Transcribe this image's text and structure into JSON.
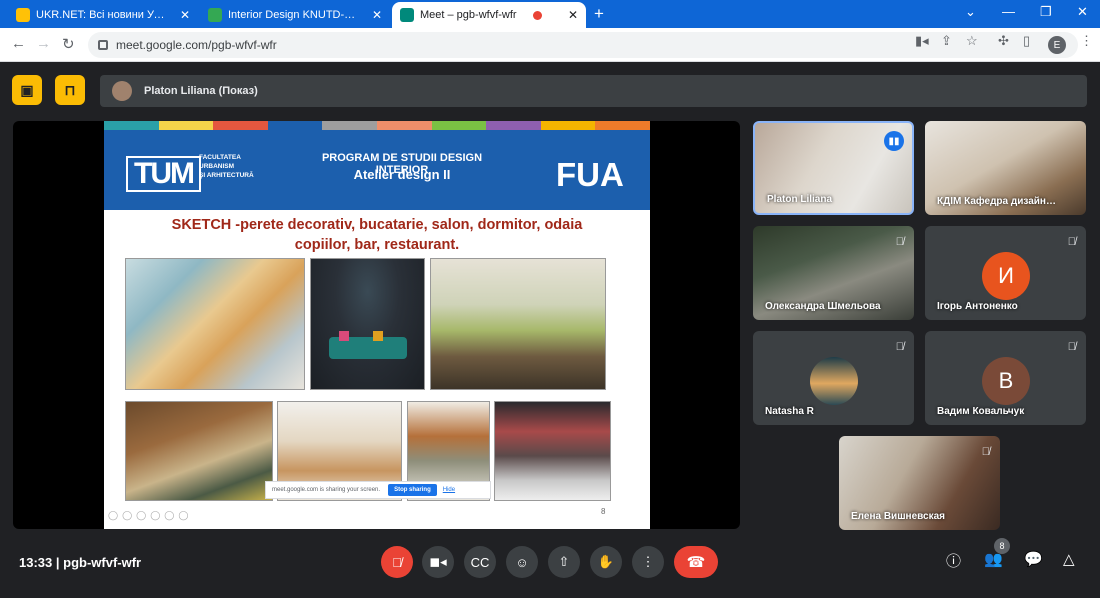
{
  "browser": {
    "tabs": [
      {
        "title": "UKR.NET: Всі новини України, с",
        "close": "✕",
        "favicon_color": "#ffc107"
      },
      {
        "title": "Interior Design KNUTD-TUM • с",
        "close": "✕",
        "favicon_color": "#34a853"
      },
      {
        "title": "Meet – pgb-wfvf-wfr",
        "close": "✕",
        "favicon_color": "#00897b",
        "recording_color": "#ea4335"
      }
    ],
    "new_tab": "+",
    "url": "meet.google.com/pgb-wfvf-wfr",
    "profile_initial": "E"
  },
  "meet": {
    "presenter_label": "Platon Liliana (Показ)",
    "slide": {
      "stripe_colors": [
        "#2aa0a8",
        "#f5d44a",
        "#e4573f",
        "#1c5fad",
        "#9e9e9e",
        "#ef8e6a",
        "#7ac143",
        "#8e5fb0",
        "#f4b400",
        "#ef7b2a"
      ],
      "logo_text": "TUM",
      "logo_sub": [
        "FACULTATEA",
        "URBANISM",
        "ŞI ARHITECTURĂ"
      ],
      "header_line1": "PROGRAM DE  STUDII DESIGN INTERIOR",
      "header_line2": "Atelier design II",
      "header_right": "FUA",
      "title_line1": "SKETCH -perete decorativ, bucatarie, salon, dormitor, odaia",
      "title_line2": "copiilor, bar, restaurant.",
      "share_text": "meet.google.com is sharing your screen.",
      "stop_label": "Stop sharing",
      "hide_label": "Hide",
      "page_number": "8"
    },
    "participants": [
      {
        "name": "Platon Liliana",
        "speaking": true
      },
      {
        "name": "КДІМ Кафедра дизайн…",
        "muted": false
      },
      {
        "name": "Олександра Шмельова",
        "muted": true
      },
      {
        "name": "Ігорь Антоненко",
        "initial": "И",
        "avatar_color": "#e8541e",
        "muted": true
      },
      {
        "name": "Natasha R",
        "muted": true
      },
      {
        "name": "Вадим Ковальчук",
        "initial": "В",
        "avatar_color": "#7a4a38",
        "muted": true
      },
      {
        "name": "Елена Вишневская",
        "muted": true
      }
    ],
    "time": "13:33",
    "meeting_code": "pgb-wfvf-wfr",
    "people_count": "8"
  }
}
